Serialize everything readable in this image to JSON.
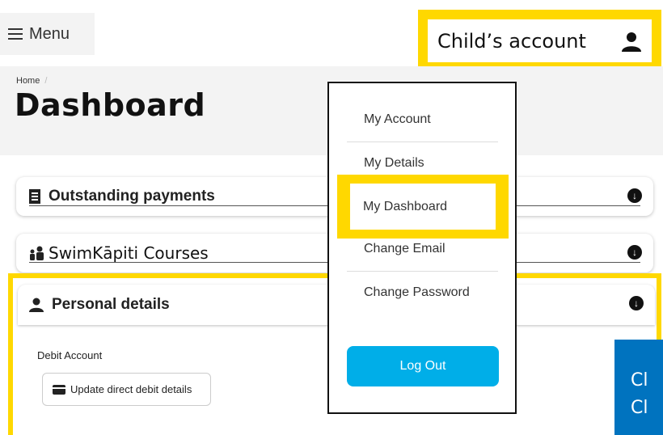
{
  "topbar": {
    "menu_label": "Menu",
    "account_label": "Child’s account",
    "account_icon": "user-icon",
    "highlight_color": "#ffd800"
  },
  "header": {
    "breadcrumb": "Home",
    "breadcrumb_sep": "/",
    "title": "Dashboard"
  },
  "panels": [
    {
      "label": "Outstanding payments",
      "icon": "receipt-icon"
    },
    {
      "label": "SwimKāpiti Courses",
      "icon": "swimmer-icon"
    },
    {
      "label": "Personal details",
      "icon": "user-icon"
    }
  ],
  "personal_details": {
    "debit_label": "Debit Account",
    "update_button": "Update direct debit details"
  },
  "dropdown": {
    "items": [
      "My Account",
      "My Details",
      "My Dashboard",
      "Change Email",
      "Change Password"
    ],
    "logout": "Log Out",
    "logout_color": "#00aee8"
  },
  "blue_card": {
    "line1": "Cl",
    "line2": "Cl",
    "color": "#0073bf"
  }
}
